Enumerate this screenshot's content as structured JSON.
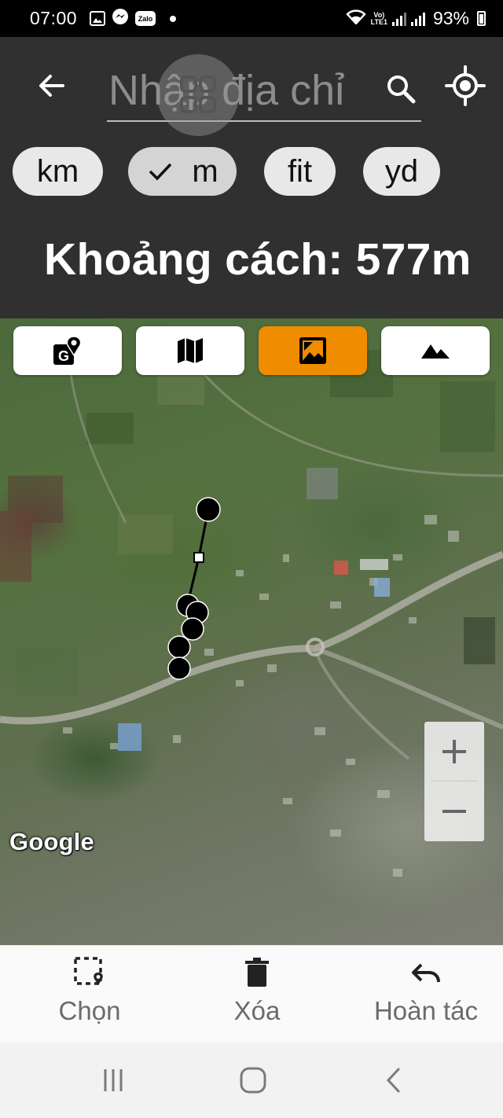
{
  "status_bar": {
    "time": "07:00",
    "notification_icons": [
      "image-icon",
      "messenger-icon",
      "zalo-icon",
      "dot-icon"
    ],
    "zalo_label": "Zalo",
    "network_label_top": "Vo)",
    "network_label_bottom": "LTE1",
    "battery_level": "93%"
  },
  "header": {
    "search_placeholder": "Nhập địa chỉ",
    "units": [
      {
        "label": "km",
        "selected": false
      },
      {
        "label": "m",
        "selected": true
      },
      {
        "label": "fit",
        "selected": false
      },
      {
        "label": "yd",
        "selected": false
      }
    ],
    "distance_text": "Khoảng cách: 577m"
  },
  "map": {
    "map_types": [
      {
        "icon": "google-maps-icon",
        "active": false
      },
      {
        "icon": "map-icon",
        "active": false
      },
      {
        "icon": "satellite-image-icon",
        "active": true
      },
      {
        "icon": "terrain-icon",
        "active": false
      }
    ],
    "active_color": "#f08c00",
    "attribution": "Google",
    "zoom_in_icon": "plus-icon",
    "zoom_out_icon": "minus-icon"
  },
  "toolbar": {
    "select_label": "Chọn",
    "delete_label": "Xóa",
    "undo_label": "Hoàn tác"
  },
  "navbar": {
    "icons": [
      "recent-apps-icon",
      "home-icon",
      "back-icon"
    ]
  }
}
